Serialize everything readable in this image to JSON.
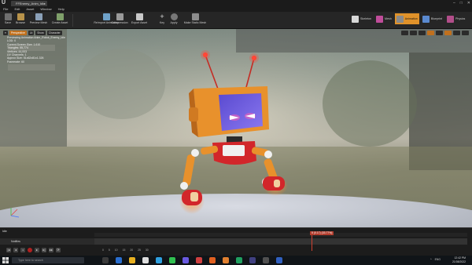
{
  "window": {
    "tab_title": "FFEnemy_Anim_Idle",
    "controls": [
      "–",
      "□",
      "✕"
    ]
  },
  "menu": [
    "File",
    "Edit",
    "Asset",
    "Window",
    "Help"
  ],
  "toolbar": {
    "buttons": [
      "Save",
      "Browse",
      "Preview Mesh",
      "Create Asset",
      "Reimport Animation",
      "Compression",
      "Export Asset",
      "Key",
      "Apply",
      "Make Static Mesh"
    ],
    "modes": [
      "Skeleton",
      "Mesh",
      "Animation",
      "Blueprint",
      "Physics"
    ],
    "active_mode": "Animation"
  },
  "viewport": {
    "left_buttons": [
      "Perspective",
      "Lit",
      "Show",
      "Character"
    ],
    "stats": [
      "Previewing Animation Anim_Robot_Enemy_Idle",
      "LOD: 0",
      "Current Screen Size: 1.610",
      "Triangles: 55,774",
      "Vertices: 44,003",
      "UV Channels: 1",
      "Approx Size: 51x62x81x1.326",
      "Framerate: 60"
    ]
  },
  "timeline": {
    "asset_label": "Idle",
    "track_label": "Notifies",
    "playhead": "5 (0.17) (33.77%)",
    "time_markers": [
      "0",
      "5",
      "10",
      "15",
      "20",
      "25",
      "30"
    ]
  },
  "taskbar": {
    "search_placeholder": "Type here to search",
    "tray": [
      "^",
      "ENG"
    ],
    "time": "12:42 PM",
    "date": "21/08/2022"
  },
  "colors": {
    "accent": "#e0922a",
    "robot_orange": "#e8912c",
    "robot_red": "#d2262a",
    "screen_purple": "#6a5ad8",
    "eye_glow": "#ff5aa0"
  }
}
